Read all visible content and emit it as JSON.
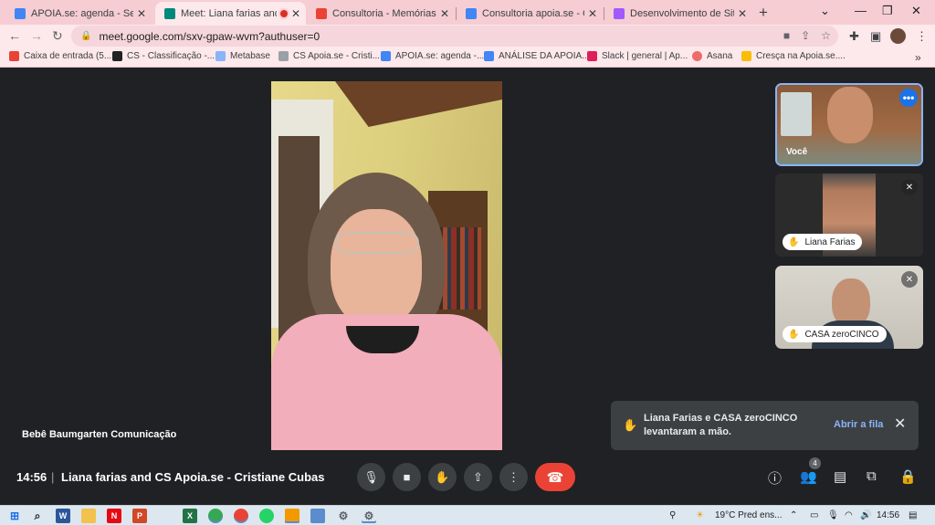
{
  "browser": {
    "tabs": [
      {
        "title": "APOIA.se: agenda - Semana",
        "favicon_color": "#4285f4"
      },
      {
        "title": "Meet: Liana farias and CS",
        "favicon_color": "#00897b"
      },
      {
        "title": "Consultoria - Memórias ribe",
        "favicon_color": "#ea4335"
      },
      {
        "title": "Consultoria apoia.se - Cristia",
        "favicon_color": "#4285f4"
      },
      {
        "title": "Desenvolvimento de Site - F",
        "favicon_color": "#a259ff"
      }
    ],
    "url": "meet.google.com/sxv-gpaw-wvm?authuser=0",
    "bookmarks": [
      {
        "label": "Caixa de entrada (5...",
        "color": "#ea4335"
      },
      {
        "label": "CS - Classificação -...",
        "color": "#202124"
      },
      {
        "label": "Metabase",
        "color": "#8ab4f8"
      },
      {
        "label": "CS Apoia.se - Cristi...",
        "color": "#9aa0a6"
      },
      {
        "label": "APOIA.se: agenda -...",
        "color": "#4285f4"
      },
      {
        "label": "ANÁLISE DA APOIA...",
        "color": "#4285f4"
      },
      {
        "label": "Slack | general | Ap...",
        "color": "#e01e5a"
      },
      {
        "label": "Asana",
        "color": "#f06a6a"
      },
      {
        "label": "Cresça na Apoia.se....",
        "color": "#fbbc04"
      }
    ],
    "more_bookmarks": "»"
  },
  "meet": {
    "main_participant": "Bebê Baumgarten Comunicação",
    "self_label": "Você",
    "participants": [
      {
        "name": "Liana Farias"
      },
      {
        "name": "CASA zeroCINCO"
      }
    ],
    "toast": {
      "message": "Liana Farias e CASA zeroCINCO levantaram a mão.",
      "action": "Abrir a fila"
    },
    "time": "14:56",
    "meeting_name": "Liana farias and CS Apoia.se - Cristiane Cubas",
    "people_count": "4"
  },
  "taskbar": {
    "weather": "19°C  Pred ens...",
    "clock": "14:56"
  }
}
